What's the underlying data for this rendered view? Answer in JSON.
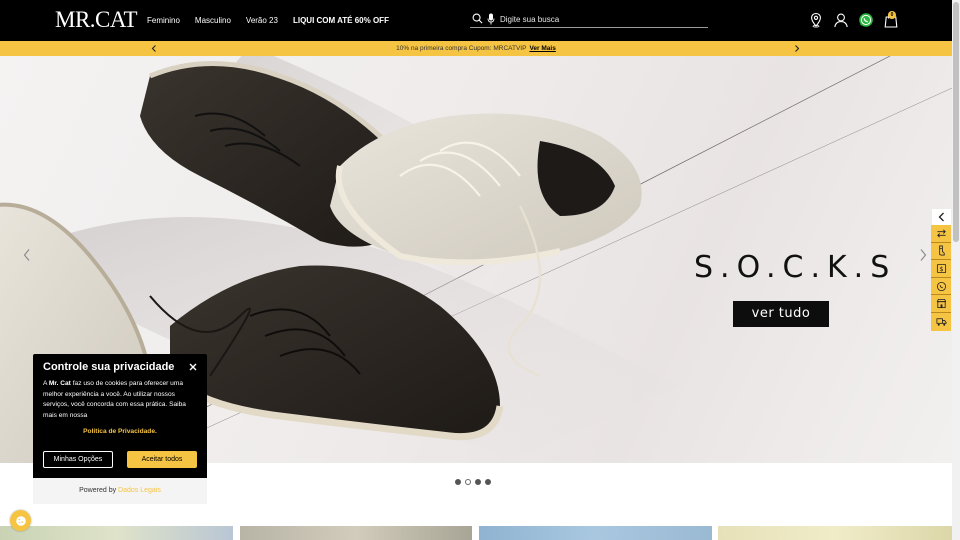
{
  "header": {
    "logo_text": "MR.CAT",
    "nav": [
      "Feminino",
      "Masculino",
      "Verão 23",
      "LIQUI COM ATÉ 60% OFF"
    ],
    "search_placeholder": "Digite sua busca",
    "icons": [
      "location-icon",
      "user-icon",
      "whatsapp-icon",
      "shopping-bag-icon"
    ],
    "cart_count": "0"
  },
  "promo_bar": {
    "text": "10% na primeira compra Cupom: MRCATVIP",
    "link": "Ver Mais"
  },
  "hero": {
    "title": "S.O.C.K.S",
    "button_label": "ver tudo",
    "slides_total": 4,
    "active_slide_index": 1
  },
  "side_widgets": [
    "swap-arrows-icon",
    "shoe-size-icon",
    "dollar-tag-icon",
    "whatsapp-icon",
    "store-icon",
    "delivery-truck-icon"
  ],
  "cookie": {
    "title": "Controle sua privacidade",
    "text_prefix": "A ",
    "brand": "Mr. Cat",
    "text_suffix": " faz uso de cookies para oferecer uma melhor experiência a você. Ao utilizar nossos serviços, você concorda com essa prática. Saiba mais em nossa",
    "policy_link": "Política de Privacidade.",
    "options_button": "Minhas Opções",
    "accept_button": "Aceitar todos",
    "powered_by": "Powered by",
    "powered_brand": "Dados Legais"
  },
  "colors": {
    "header_bg": "#000000",
    "accent_yellow": "#f6c443",
    "hero_button_bg": "#0d0d0d"
  }
}
